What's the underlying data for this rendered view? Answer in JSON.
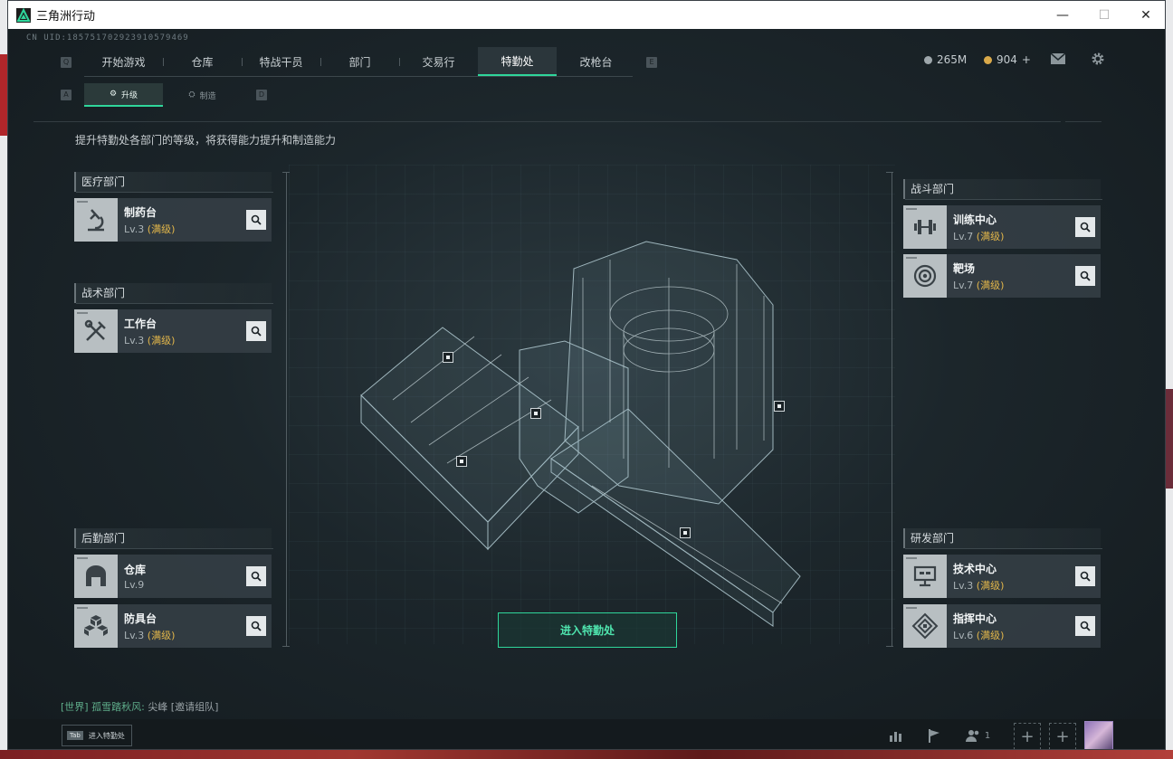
{
  "window": {
    "title": "三角洲行动",
    "controls": {
      "minimize": "—",
      "maximize": "☐",
      "close": "✕"
    }
  },
  "header": {
    "uid": "CN UID:1857517029239105794​69",
    "hint_left": "Q",
    "hint_right": "E",
    "tabs": [
      {
        "label": "开始游戏",
        "active": false
      },
      {
        "label": "仓库",
        "active": false
      },
      {
        "label": "特战干员",
        "active": false
      },
      {
        "label": "部门",
        "active": false
      },
      {
        "label": "交易行",
        "active": false
      },
      {
        "label": "特勤处",
        "active": true
      },
      {
        "label": "改枪台",
        "active": false
      }
    ],
    "currency_a": "265M",
    "currency_b": "904",
    "currency_b_add": "+",
    "accent": "#2fd69b"
  },
  "subnav": {
    "hint_left": "A",
    "hint_right": "D",
    "tabs": [
      {
        "label": "升级",
        "active": true
      },
      {
        "label": "制造",
        "active": false
      }
    ]
  },
  "description": "提升特勤处各部门的等级，将获得能力提升和制造能力",
  "departments": {
    "medical": {
      "label": "医疗部门",
      "stations": [
        {
          "name": "制药台",
          "level": "Lv.3",
          "status": "(满级)",
          "icon": "microscope-icon"
        }
      ]
    },
    "tactical": {
      "label": "战术部门",
      "stations": [
        {
          "name": "工作台",
          "level": "Lv.3",
          "status": "(满级)",
          "icon": "tools-icon"
        }
      ]
    },
    "logistics": {
      "label": "后勤部门",
      "stations": [
        {
          "name": "仓库",
          "level": "Lv.9",
          "status": "",
          "icon": "warehouse-icon"
        },
        {
          "name": "防具台",
          "level": "Lv.3",
          "status": "(满级)",
          "icon": "armor-boxes-icon"
        }
      ]
    },
    "combat": {
      "label": "战斗部门",
      "stations": [
        {
          "name": "训练中心",
          "level": "Lv.7",
          "status": "(满级)",
          "icon": "dumbbell-icon"
        },
        {
          "name": "靶场",
          "level": "Lv.7",
          "status": "(满级)",
          "icon": "target-icon"
        }
      ]
    },
    "research": {
      "label": "研发部门",
      "stations": [
        {
          "name": "技术中心",
          "level": "Lv.3",
          "status": "(满级)",
          "icon": "monitor-icon"
        },
        {
          "name": "指挥中心",
          "level": "Lv.6",
          "status": "(满级)",
          "icon": "command-chip-icon"
        }
      ]
    }
  },
  "enter_button": "进入特勤处",
  "chat": {
    "channel": "[世界]",
    "user": "孤雪踏秋风:",
    "message": "尖峰 [邀请组队]"
  },
  "bottom": {
    "tab_key": "Tab",
    "tab_label": "进入特勤处",
    "friends_count": "1"
  }
}
